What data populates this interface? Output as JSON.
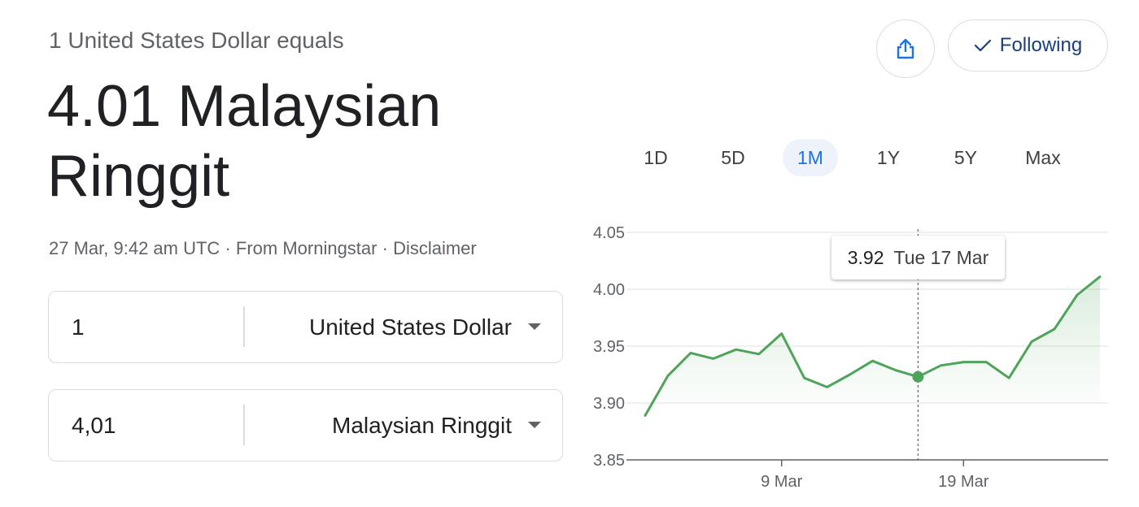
{
  "header": {
    "subtitle": "1 United States Dollar equals",
    "result": "4.01 Malaysian Ringgit",
    "timestamp": "27 Mar, 9:42 am UTC",
    "separator": "·",
    "source": "From Morningstar",
    "disclaimer": "Disclaimer"
  },
  "actions": {
    "share_icon": "share-icon",
    "following_label": "Following",
    "following_icon": "checkmark-icon"
  },
  "converter": {
    "from": {
      "amount": "1",
      "currency": "United States Dollar"
    },
    "to": {
      "amount": "4,01",
      "currency": "Malaysian Ringgit"
    }
  },
  "ranges": [
    "1D",
    "5D",
    "1M",
    "1Y",
    "5Y",
    "Max"
  ],
  "active_range": "1M",
  "colors": {
    "line": "#4fa35a",
    "accent": "#1a73e8",
    "following": "#1a3f7a"
  },
  "tooltip": {
    "value": "3.92",
    "date": "Tue 17 Mar"
  },
  "chart_data": {
    "type": "area",
    "ylim": [
      3.85,
      4.05
    ],
    "y_ticks": [
      "4.05",
      "4.00",
      "3.95",
      "3.90",
      "3.85"
    ],
    "x_ticks": [
      "9 Mar",
      "19 Mar"
    ],
    "grid": true,
    "x": [
      "",
      "",
      "",
      "",
      "",
      "",
      "9 Mar",
      "",
      "",
      "",
      "",
      "",
      "17 Mar",
      "",
      "19 Mar",
      "",
      "",
      "",
      "",
      "",
      "27 Mar"
    ],
    "values": [
      3.889,
      3.924,
      3.944,
      3.939,
      3.947,
      3.943,
      3.961,
      3.922,
      3.914,
      3.925,
      3.937,
      3.929,
      3.923,
      3.933,
      3.936,
      3.936,
      3.922,
      3.954,
      3.965,
      3.995,
      4.011
    ],
    "highlight_index": 12
  }
}
